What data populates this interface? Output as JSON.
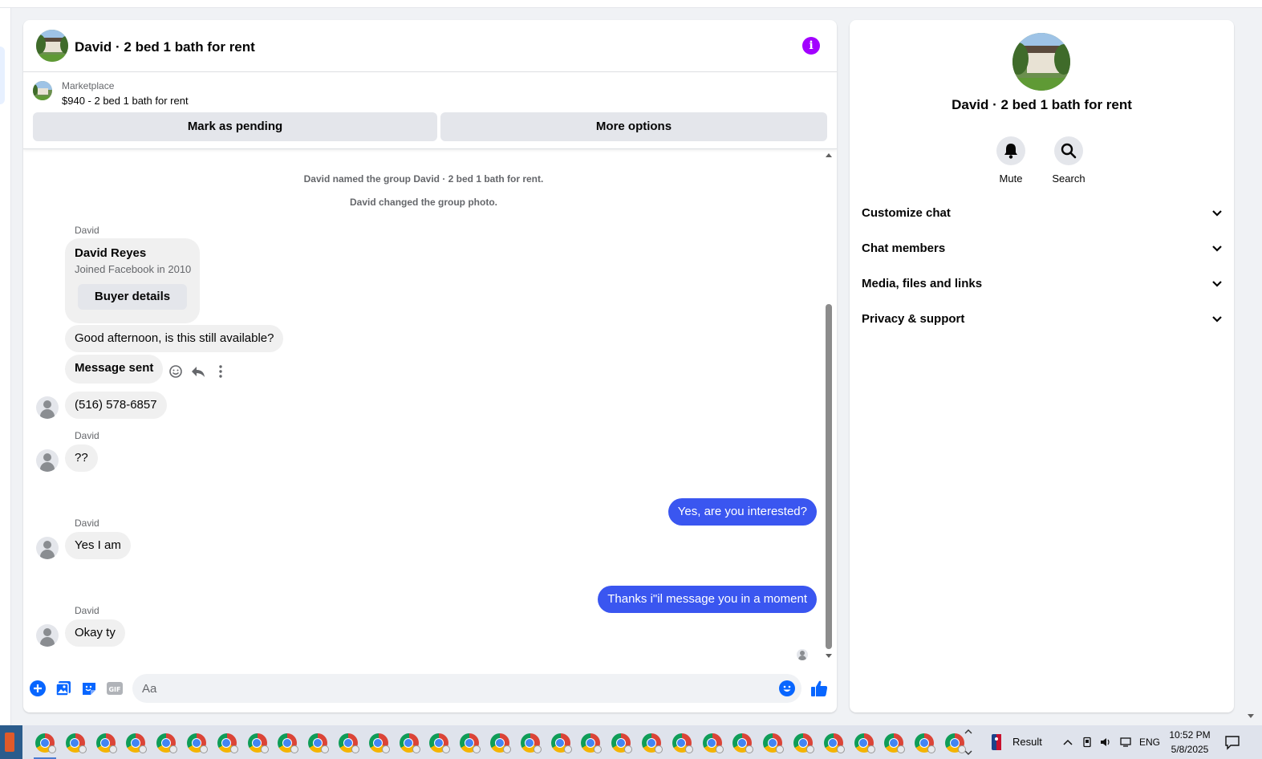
{
  "chat": {
    "title": "David · 2 bed 1 bath for rent",
    "marketplace_label": "Marketplace",
    "listing": "$940 - 2 bed 1 bath for rent",
    "btn_pending": "Mark as pending",
    "btn_more": "More options",
    "system_messages": [
      "David named the group David · 2 bed 1 bath for rent.",
      "David changed the group photo."
    ],
    "card": {
      "sender": "David",
      "name": "David Reyes",
      "joined": "Joined Facebook in 2010",
      "button": "Buyer details"
    },
    "messages": [
      {
        "text": "Good afternoon, is this still available?"
      },
      {
        "text": "Message sent"
      },
      {
        "text": "(516) 578-6857"
      },
      {
        "sender": "David",
        "text": "??"
      },
      {
        "text": "Yes, are you interested?"
      },
      {
        "sender": "David",
        "text": "Yes I am"
      },
      {
        "text": "Thanks i\"il message you in a moment"
      },
      {
        "sender": "David",
        "text": "Okay ty"
      }
    ],
    "composer_placeholder": "Aa",
    "colors": {
      "accent": "#3a56f0",
      "info": "#a200ff",
      "button_bg": "#e4e6eb"
    }
  },
  "side": {
    "title": "David · 2 bed 1 bath for rent",
    "actions": [
      {
        "label": "Mute",
        "icon": "bell-icon"
      },
      {
        "label": "Search",
        "icon": "search-icon"
      }
    ],
    "sections": [
      "Customize chat",
      "Chat members",
      "Media, files and links",
      "Privacy & support"
    ]
  },
  "taskbar": {
    "result_label": "Result",
    "lang": "ENG",
    "time": "10:52 PM",
    "date": "5/8/2025"
  }
}
